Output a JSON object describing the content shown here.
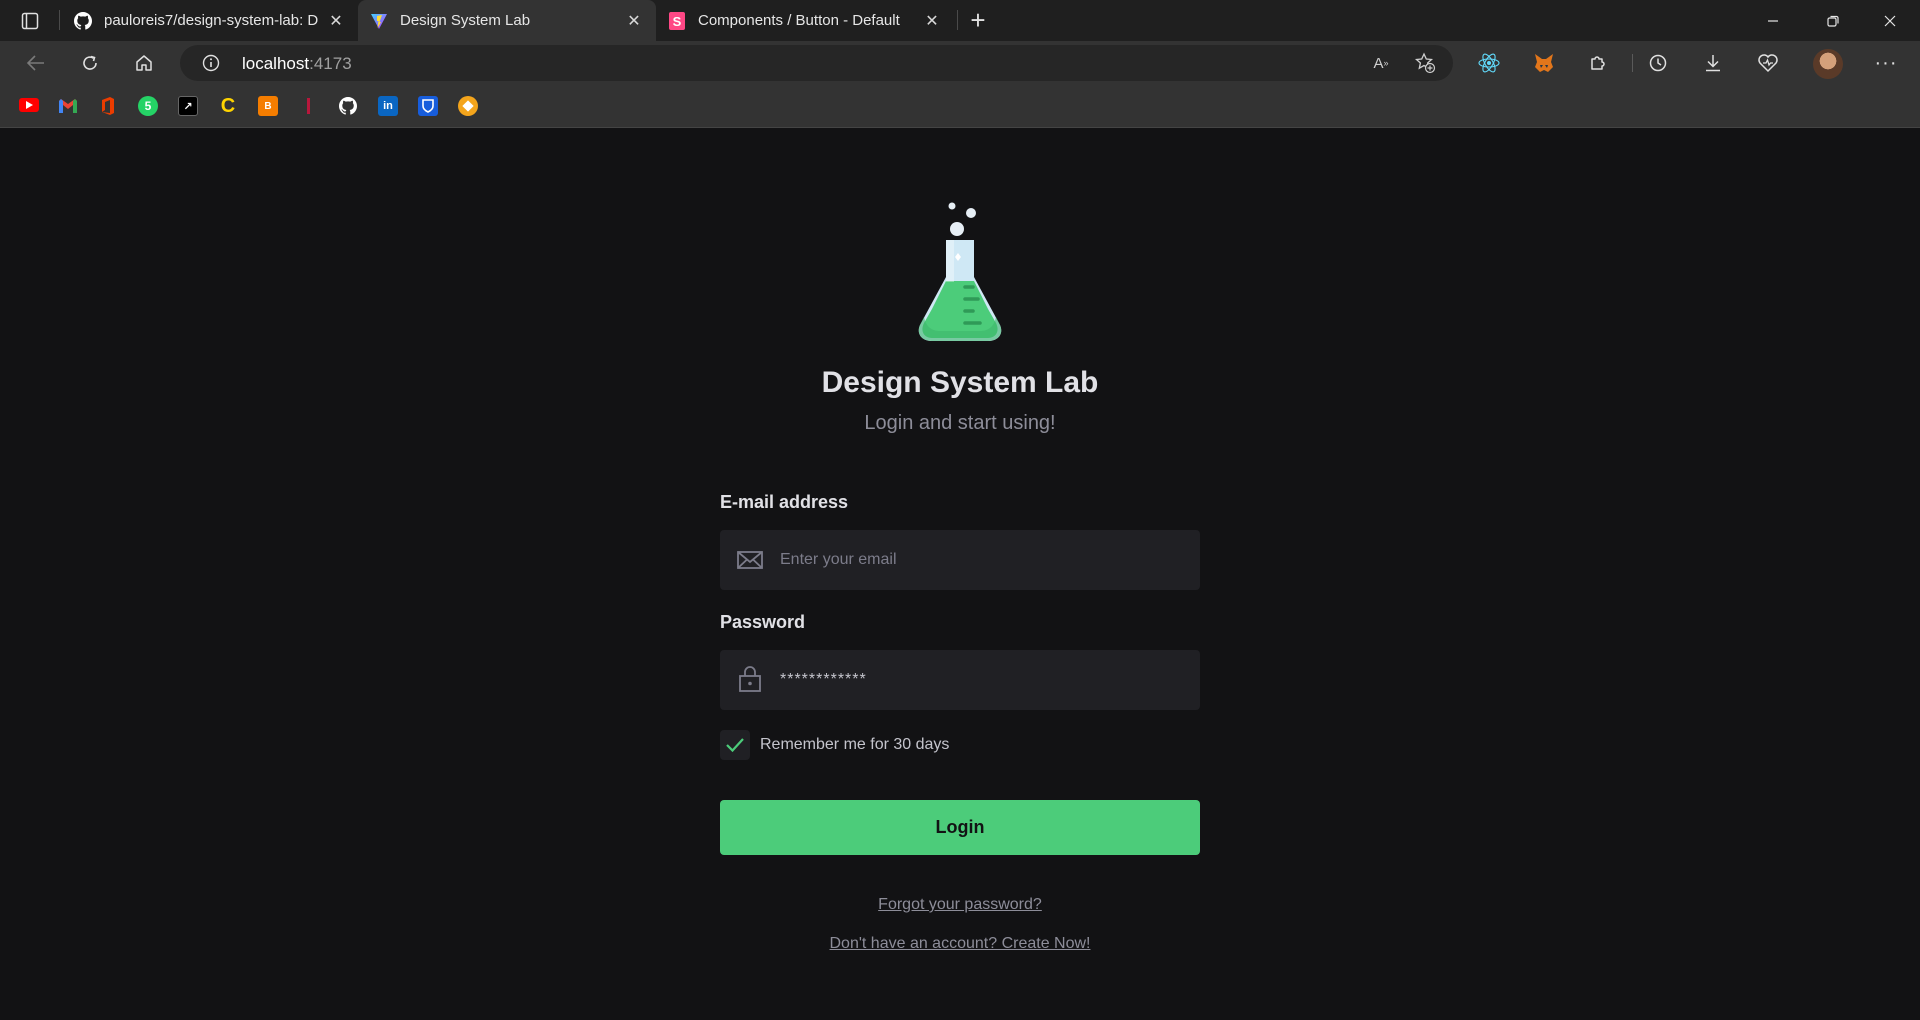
{
  "browser": {
    "tabs": [
      {
        "title": "pauloreis7/design-system-lab: D",
        "favicon": "github-icon",
        "active": false
      },
      {
        "title": "Design System Lab",
        "favicon": "vite-icon",
        "active": true
      },
      {
        "title": "Components / Button - Default",
        "favicon": "storybook-icon",
        "active": false
      }
    ],
    "url_host": "localhost",
    "url_port": ":4173",
    "bookmarks": [
      "youtube-icon",
      "gmail-icon",
      "office-icon",
      "whatsapp-icon",
      "notion-icon",
      "coursera-icon",
      "blogger-icon",
      "bookmark-icon",
      "github-icon",
      "linkedin-icon",
      "bitwarden-icon",
      "app-icon"
    ],
    "colors": {
      "tabbar": "#1f1f1f",
      "toolbar": "#333333",
      "omnibox": "#262626"
    }
  },
  "app": {
    "title": "Design System Lab",
    "subtitle": "Login and start using!",
    "email": {
      "label": "E-mail address",
      "placeholder": "Enter your email",
      "value": ""
    },
    "password": {
      "label": "Password",
      "value": "************"
    },
    "remember": {
      "label": "Remember me for 30 days",
      "checked": true
    },
    "login_button": "Login",
    "forgot_link": "Forgot your password?",
    "signup_link": "Don't have an account? Create Now!",
    "colors": {
      "background": "#121214",
      "input": "#202024",
      "accent": "#4ccc7a",
      "text": "#e1e1e6",
      "muted": "#8d8d99"
    }
  }
}
